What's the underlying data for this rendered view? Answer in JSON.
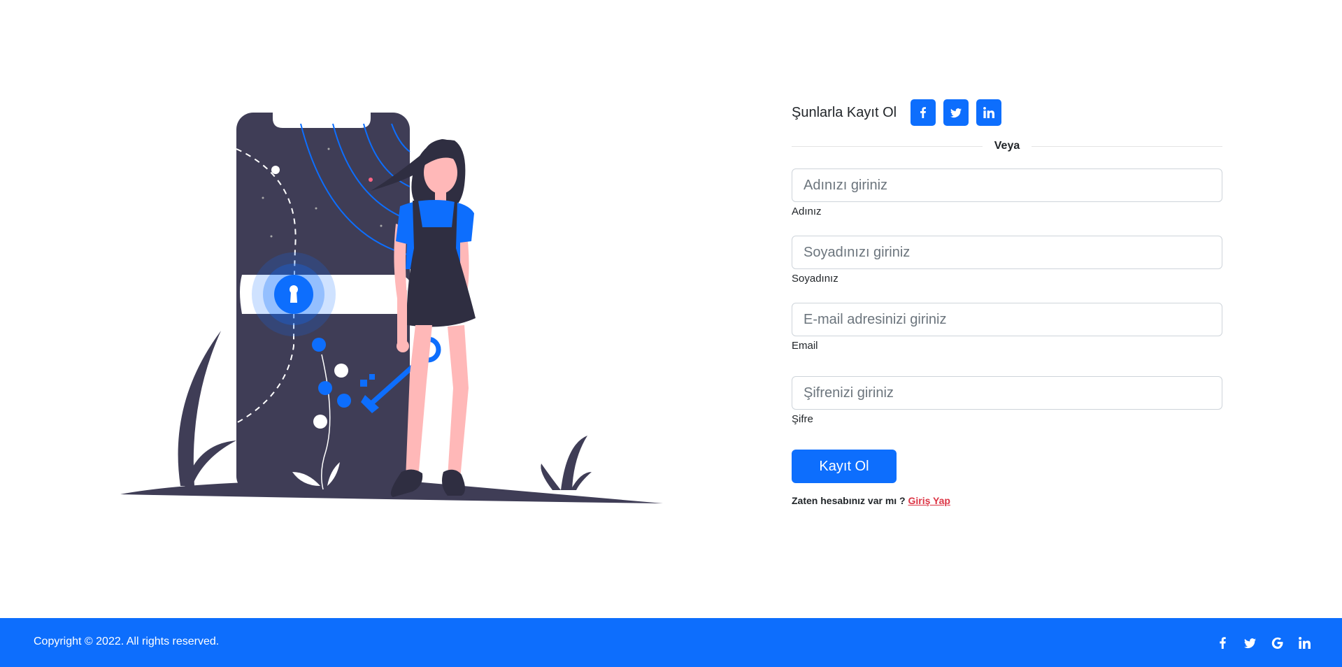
{
  "signup": {
    "social_lead": "Şunlarla Kayıt Ol",
    "social_buttons": [
      "facebook-icon",
      "twitter-icon",
      "linkedin-icon"
    ],
    "divider_text": "Veya"
  },
  "fields": {
    "first_name": {
      "placeholder": "Adınızı giriniz",
      "label": "Adınız",
      "value": ""
    },
    "last_name": {
      "placeholder": "Soyadınızı giriniz",
      "label": "Soyadınız",
      "value": ""
    },
    "email": {
      "placeholder": "E-mail adresinizi giriniz",
      "label": "Email",
      "value": ""
    },
    "password": {
      "placeholder": "Şifrenizi giriniz",
      "label": "Şifre",
      "value": ""
    }
  },
  "submit_label": "Kayıt Ol",
  "login_prompt": "Zaten hesabınız var mı ?",
  "login_link": "Giriş Yap",
  "footer": {
    "copyright": "Copyright © 2022. All rights reserved.",
    "icons": [
      "facebook-icon",
      "twitter-icon",
      "google-icon",
      "linkedin-icon"
    ]
  },
  "colors": {
    "primary": "#0d6efd",
    "dark_illustration": "#3f3d56",
    "skin": "#ffb8b8",
    "login_link": "#dc3545"
  }
}
